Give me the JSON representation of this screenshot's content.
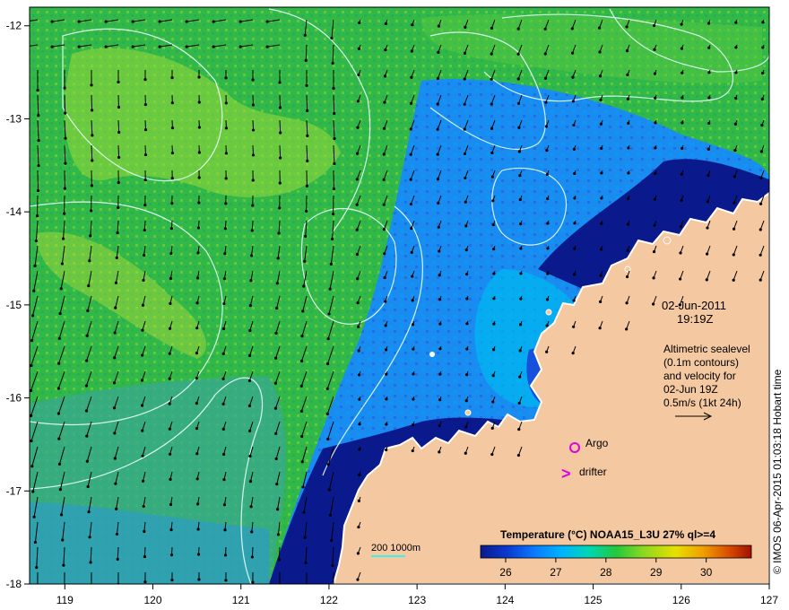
{
  "map": {
    "lon_ticks": [
      "119",
      "120",
      "121",
      "122",
      "123",
      "124",
      "125",
      "126",
      "127"
    ],
    "lat_ticks": [
      "-12",
      "-13",
      "-14",
      "-15",
      "-16",
      "-17",
      "-18"
    ],
    "lon_range": [
      118.6,
      127
    ],
    "lat_range": [
      -18,
      -11.8
    ]
  },
  "info": {
    "date": "02-Jun-2011",
    "time": "19:19Z",
    "altimetry_lines": [
      "Altimetric sealevel",
      "(0.1m contours)",
      "and velocity for",
      "02-Jun 19Z",
      "0.5m/s (1kt 24h)"
    ]
  },
  "legend": {
    "argo_label": "Argo",
    "drifter_label": "drifter",
    "drifter_symbol": ">",
    "argo_color": "#e000e0"
  },
  "colorbar": {
    "title": "Temperature (°C) NOAA15_L3U 27% ql>=4",
    "ticks": [
      "26",
      "27",
      "28",
      "29",
      "30"
    ],
    "colors": [
      "#0a1a8c",
      "#0a3ad0",
      "#0a7aff",
      "#00b4ff",
      "#00d6b4",
      "#22c83c",
      "#8ad820",
      "#e8e000",
      "#f0a000",
      "#d84a00",
      "#a01000"
    ]
  },
  "depth_label": "200  1000m",
  "credit": "© IMOS 06-Apr-2015 01:03:18 Hobart time",
  "colors": {
    "land": "#f4c8a0",
    "deep_blue": "#0a1a8c",
    "green": "#3cb83c",
    "contour": "#e8ffff"
  }
}
